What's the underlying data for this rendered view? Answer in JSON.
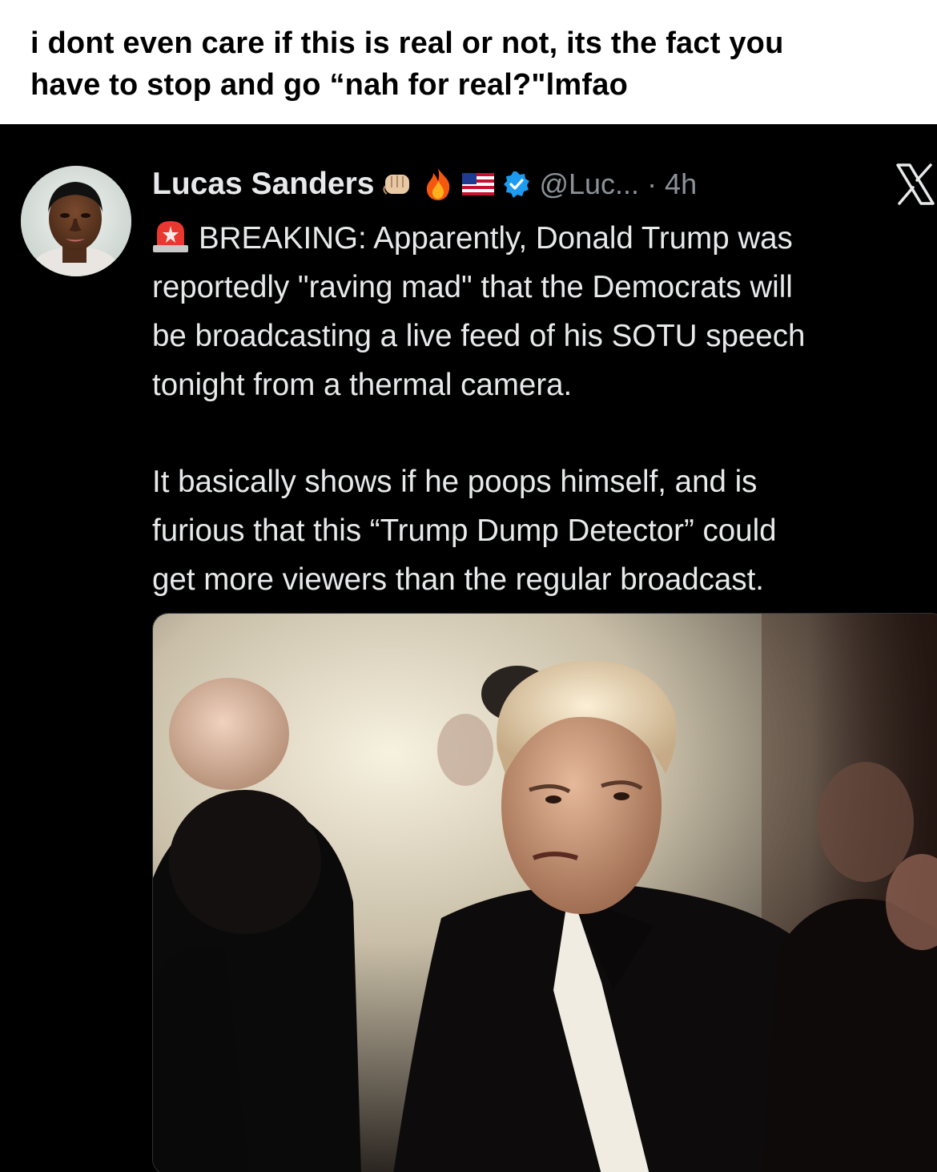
{
  "caption": {
    "line1": "i dont even care if this is real or not, its the fact you",
    "line2": "have to stop and go “nah for real?\"lmfao"
  },
  "tweet": {
    "display_name": "Lucas Sanders",
    "badges": [
      "fist-emoji-icon",
      "fire-emoji-icon",
      "us-flag-icon",
      "verified-icon"
    ],
    "handle": "@Luc... · 4h",
    "platform_icon": "x-logo-icon",
    "body": {
      "line1": "BREAKING: Apparently, Donald Trump was",
      "line2": "reportedly \"raving mad\" that the Democrats will",
      "line3": "be broadcasting a live feed of his SOTU speech",
      "line4": "tonight from a thermal camera.",
      "line5": "It basically shows if he poops himself, and is",
      "line6": "furious that this “Trump Dump Detector” could",
      "line7": "get more viewers than the regular broadcast."
    },
    "lead_icon": "rotating-light-emoji-icon",
    "media": "photo"
  },
  "colors": {
    "tweet_background": "#000000",
    "tweet_text": "#e7e9ea",
    "secondary_text": "#8b9399",
    "verified_blue": "#1d9bf0"
  }
}
